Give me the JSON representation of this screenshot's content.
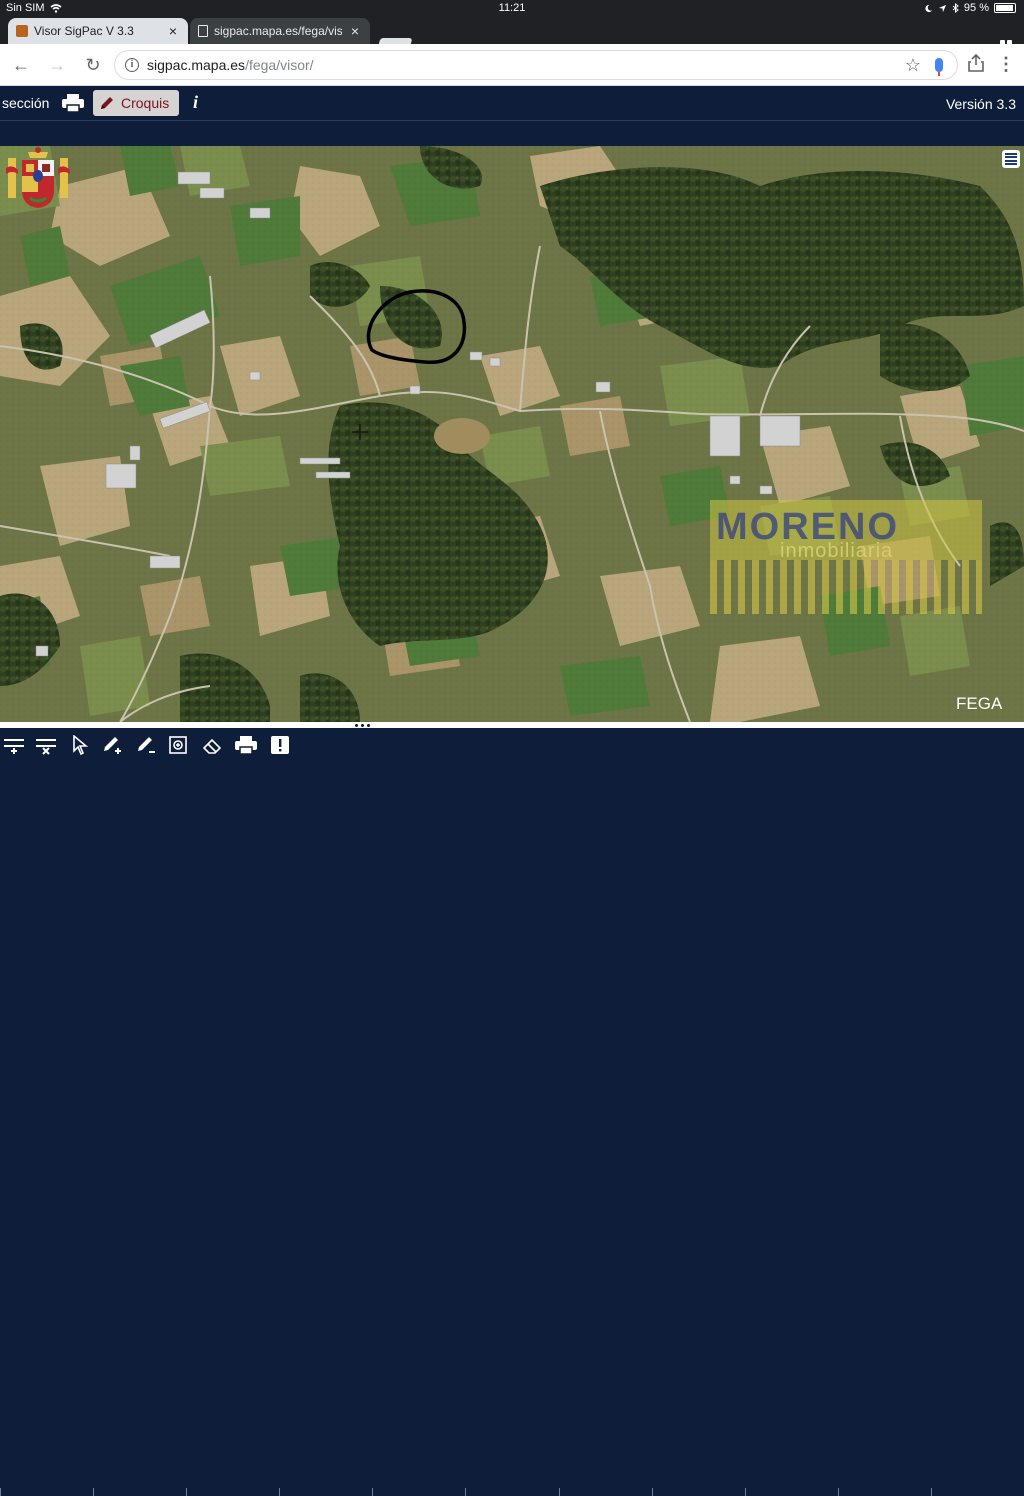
{
  "status_bar": {
    "carrier": "Sin SIM",
    "time": "11:21",
    "battery": "95 %",
    "battery_level": 0.95
  },
  "browser": {
    "tabs": [
      {
        "title": "Visor SigPac V 3.3",
        "active": true,
        "icon": "sigpac-favicon-icon"
      },
      {
        "title": "sigpac.mapa.es/fega/visor/",
        "active": false,
        "icon": "document-icon"
      }
    ],
    "url_host": "sigpac.mapa.es",
    "url_path": "/fega/visor/"
  },
  "app": {
    "menu_seccion": "sección",
    "croquis_label": "Croquis",
    "info_label": "i",
    "version": "Versión 3.3"
  },
  "map": {
    "annotation": "hand-drawn ellipse around parcel",
    "watermark_title": "MORENO",
    "watermark_subtitle": "inmobiliaria",
    "agency_label": "FEGA"
  },
  "bottom_toolbar": {
    "tools": [
      {
        "name": "add-row-icon"
      },
      {
        "name": "delete-row-icon"
      },
      {
        "name": "select-pointer-icon"
      },
      {
        "name": "draw-add-icon"
      },
      {
        "name": "draw-remove-icon"
      },
      {
        "name": "zoom-box-icon"
      },
      {
        "name": "eraser-icon"
      },
      {
        "name": "print-icon"
      },
      {
        "name": "alert-icon"
      }
    ]
  },
  "colors": {
    "header_bg": "#0d1d3a",
    "croquis_text": "#7a1222",
    "croquis_bg": "#d6d4d2",
    "annotation_stroke": "#000000"
  }
}
